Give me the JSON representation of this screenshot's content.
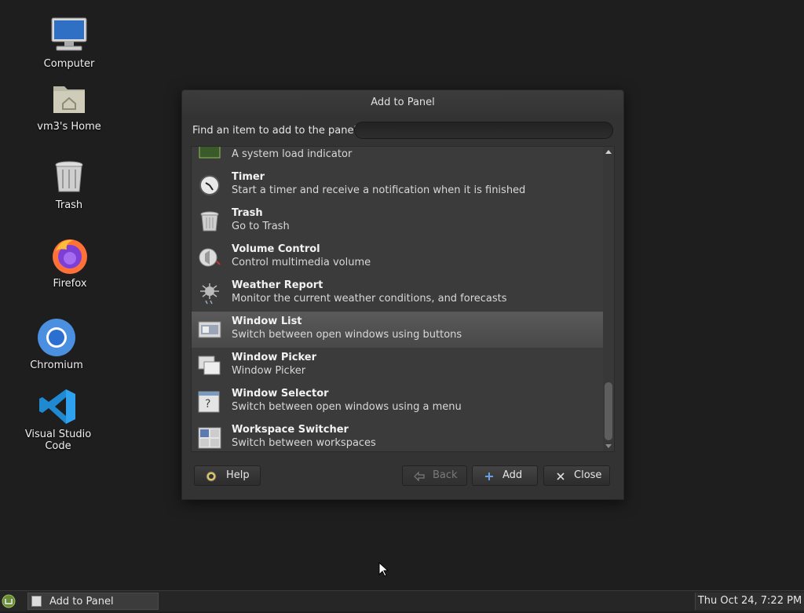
{
  "desktop": {
    "icons": [
      {
        "label": "Computer",
        "icon": "computer-icon"
      },
      {
        "label": "vm3's Home",
        "icon": "home-folder-icon"
      },
      {
        "label": "Trash",
        "icon": "trash-icon"
      },
      {
        "label": "Firefox",
        "icon": "firefox-icon"
      },
      {
        "label": "Chromium",
        "icon": "chromium-icon"
      },
      {
        "label": "Visual Studio Code",
        "icon": "vscode-icon"
      }
    ]
  },
  "dialog": {
    "title": "Add to Panel",
    "find_label": "Find an item to add to the panel:",
    "find_value": "",
    "items": [
      {
        "name": "",
        "desc": "A system load indicator",
        "icon": "system-monitor-icon",
        "selected": false
      },
      {
        "name": "Timer",
        "desc": "Start a timer and receive a notification when it is finished",
        "icon": "timer-icon",
        "selected": false
      },
      {
        "name": "Trash",
        "desc": "Go to Trash",
        "icon": "trash-icon",
        "selected": false
      },
      {
        "name": "Volume Control",
        "desc": "Control multimedia volume",
        "icon": "volume-icon",
        "selected": false
      },
      {
        "name": "Weather Report",
        "desc": "Monitor the current weather conditions, and forecasts",
        "icon": "weather-icon",
        "selected": false
      },
      {
        "name": "Window List",
        "desc": "Switch between open windows using buttons",
        "icon": "window-list-icon",
        "selected": true
      },
      {
        "name": "Window Picker",
        "desc": "Window Picker",
        "icon": "window-picker-icon",
        "selected": false
      },
      {
        "name": "Window Selector",
        "desc": "Switch between open windows using a menu",
        "icon": "window-selector-icon",
        "selected": false
      },
      {
        "name": "Workspace Switcher",
        "desc": "Switch between workspaces",
        "icon": "workspace-switcher-icon",
        "selected": false
      }
    ],
    "buttons": {
      "help": "Help",
      "back": "Back",
      "add": "Add",
      "close": "Close"
    }
  },
  "taskbar": {
    "task_label": "Add to Panel",
    "clock": "Thu Oct 24,  7:22 PM"
  }
}
